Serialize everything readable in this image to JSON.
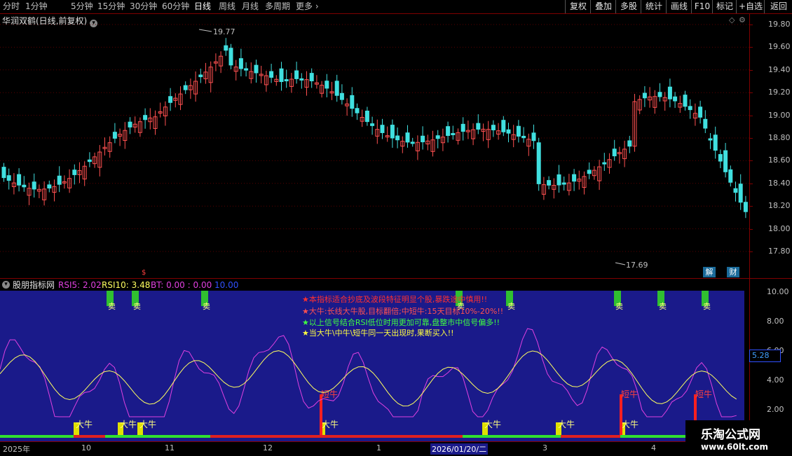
{
  "toolbar": {
    "periods": [
      "分时",
      "1分钟",
      "5分钟",
      "15分钟",
      "30分钟",
      "60分钟",
      "日线",
      "周线",
      "月线",
      "多周期",
      "更多"
    ],
    "active_period": "日线",
    "right_buttons": [
      "复权",
      "叠加",
      "多股",
      "统计",
      "画线",
      "F10",
      "标记",
      "+自选",
      "返回"
    ]
  },
  "main": {
    "title": "华润双鹤(日线,前复权)",
    "high_label": "19.77",
    "low_label": "17.69",
    "y_ticks": [
      "19.80",
      "19.60",
      "19.40",
      "19.20",
      "19.00",
      "18.80",
      "18.60",
      "18.40",
      "18.20",
      "18.00",
      "17.80"
    ],
    "corner_buttons": [
      "解",
      "财"
    ]
  },
  "indicator": {
    "name": "股朋指标网",
    "rsi5_label": "RSI5: 2.02",
    "rsi10_label": "RSI10: 3.48",
    "bt_label": "BT: 0.00 : 0.00",
    "extra_label": "10.00",
    "y_ticks": [
      "10.00",
      "8.00",
      "6.00",
      "4.00",
      "2.00"
    ],
    "current_value": "5.28",
    "notes": [
      "★本指标适合抄底及波段特征明显个股,暴跌途中慎用!!",
      "★大牛:长线大牛股,目标翻倍;中短牛:15天目标10%-20%!!",
      "★以上信号结合RSI低位时用更加可靠,盘整市中信号偏多!!",
      "★当大牛\\中牛\\短牛同一天出现时,果断买入!!"
    ],
    "buy_big_label": "大牛",
    "buy_short_label": "短牛",
    "sell_label": "卖",
    "colors": {
      "rsi5": "#e040e0",
      "rsi10": "#ffff60",
      "panel": "#1a1a8a",
      "up": "#ff5050",
      "down": "#40e0e0"
    }
  },
  "timeline": {
    "labels": [
      "2025年",
      "10",
      "11",
      "12",
      "1",
      "2026/01/20/二",
      "3",
      "4"
    ]
  },
  "watermark": {
    "name": "乐淘公式网",
    "url": "www.60lt.com"
  }
}
